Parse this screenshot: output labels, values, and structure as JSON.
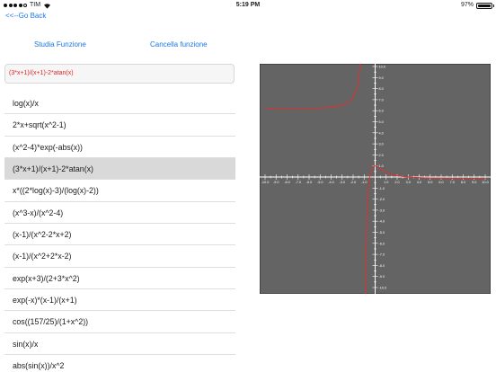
{
  "status": {
    "carrier": "TIM",
    "time": "5:19 PM",
    "battery": "97%",
    "battery_level": 0.97,
    "signal_bars": 4
  },
  "nav": {
    "back_label": "<<--Go Back"
  },
  "actions": {
    "studia_label": "Studia Funzione",
    "cancella_label": "Cancella funzione"
  },
  "function_field": {
    "value": "(3*x+1)/(x+1)-2*atan(x)"
  },
  "function_list": {
    "selected_index": 3,
    "items": [
      "log(x)/x",
      "2*x+sqrt(x^2-1)",
      "(x^2-4)*exp(-abs(x))",
      "(3*x+1)/(x+1)-2*atan(x)",
      "x*((2*log(x)-3)/(log(x)-2))",
      "(x^3-x)/(x^2-4)",
      "(x-1)/(x^2-2*x+2)",
      "(x-1)/(x^2+2*x-2)",
      "exp(x+3)/(2+3*x^2)",
      "exp(-x)*(x-1)/(x+1)",
      "cos((157/25)/(1+x^2))",
      "sin(x)/x",
      "abs(sin(x))/x^2"
    ]
  },
  "colors": {
    "link": "#1e78e6",
    "function_text": "#e02424",
    "plot_bg": "#646464",
    "axis": "#ffffff",
    "curve": "#e03030",
    "selected_row": "#d9d9d9"
  },
  "chart_data": {
    "type": "line",
    "function": "(3*x+1)/(x+1)-2*atan(x)",
    "xlim": [
      -10,
      10
    ],
    "ylim": [
      -10,
      10
    ],
    "x_ticks": [
      "-10.0",
      "-9.0",
      "-8.0",
      "-7.0",
      "-6.0",
      "-5.0",
      "-4.0",
      "-3.0",
      "-2.0",
      "-1.0",
      "0",
      "1.0",
      "2.0",
      "3.0",
      "4.0",
      "5.0",
      "6.0",
      "7.0",
      "8.0",
      "9.0",
      "10.0"
    ],
    "y_ticks": [
      "10.0",
      "9.0",
      "8.0",
      "7.0",
      "6.0",
      "5.0",
      "4.0",
      "3.0",
      "2.0",
      "1.0",
      "0",
      "-1.0",
      "-2.0",
      "-3.0",
      "-4.0",
      "-5.0",
      "-6.0",
      "-7.0",
      "-8.0",
      "-9.0",
      "-10.0"
    ],
    "grid": false,
    "asymptote_x": -1
  }
}
